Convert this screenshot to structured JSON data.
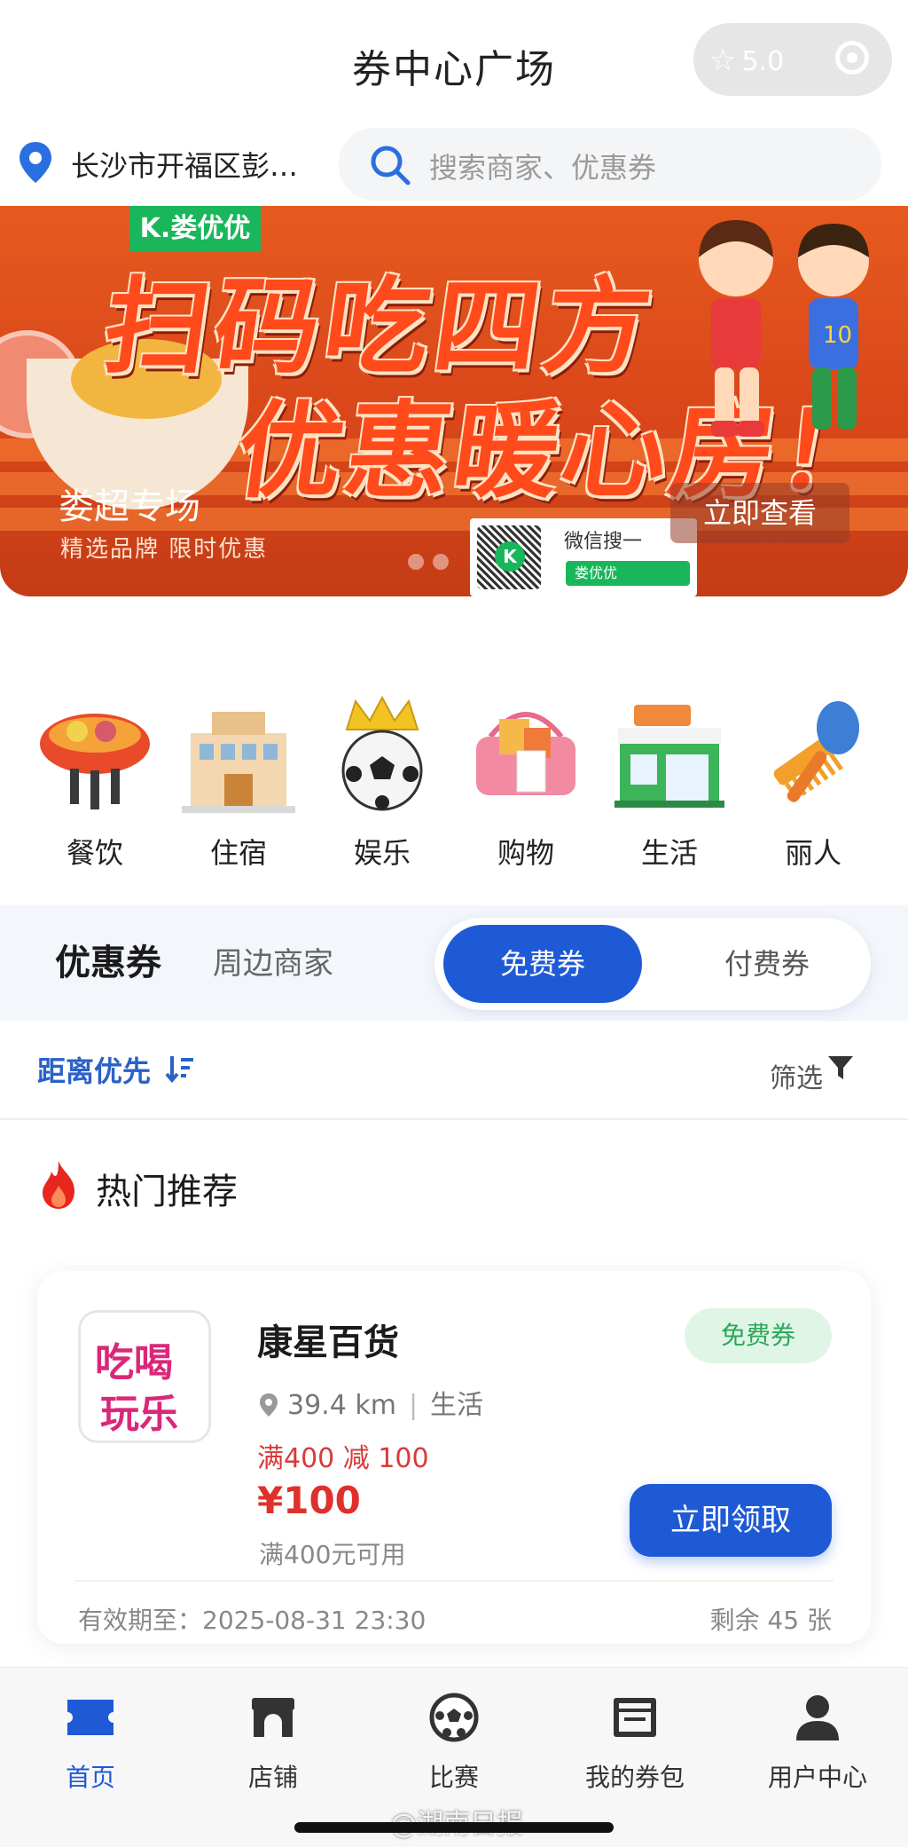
{
  "header": {
    "title": "券中心广场",
    "rating": "5.0"
  },
  "location": {
    "text": "长沙市开福区彭…"
  },
  "search": {
    "placeholder": "搜索商家、优惠券"
  },
  "banner": {
    "brand": "K.娄优优",
    "headline1": "扫码吃四方",
    "headline2": "优惠暖心房！",
    "subtitle": "娄超专场",
    "tagline": "精选品牌 限时优惠",
    "cta": "立即查看",
    "qr_text": "微信搜一",
    "qr_bar": "娄优优",
    "qr_center": "K"
  },
  "categories": [
    {
      "label": "餐饮",
      "icon": "grill-icon"
    },
    {
      "label": "住宿",
      "icon": "hotel-icon"
    },
    {
      "label": "娱乐",
      "icon": "soccer-crown-icon"
    },
    {
      "label": "购物",
      "icon": "shopping-basket-icon"
    },
    {
      "label": "生活",
      "icon": "market-icon"
    },
    {
      "label": "丽人",
      "icon": "comb-brush-icon"
    }
  ],
  "tabs": {
    "primary": "优惠券",
    "secondary": "周边商家",
    "segment_active": "免费券",
    "segment_inactive": "付费券"
  },
  "sort": {
    "distance": "距离优先",
    "filter": "筛选"
  },
  "section": {
    "title": "热门推荐"
  },
  "card": {
    "logo_line1": "吃喝",
    "logo_line2": "玩乐",
    "name": "康星百货",
    "badge": "免费券",
    "distance": "39.4 km",
    "category": "生活",
    "rule": "满400 减 100",
    "price": "¥100",
    "condition": "满400元可用",
    "button": "立即领取",
    "expiry": "有效期至：2025-08-31 23:30",
    "remaining": "剩余 45 张"
  },
  "bottom_nav": [
    {
      "label": "首页",
      "icon": "ticket-icon",
      "active": true
    },
    {
      "label": "店铺",
      "icon": "store-icon",
      "active": false
    },
    {
      "label": "比赛",
      "icon": "soccer-ball-icon",
      "active": false
    },
    {
      "label": "我的券包",
      "icon": "wallet-icon",
      "active": false
    },
    {
      "label": "用户中心",
      "icon": "user-icon",
      "active": false
    }
  ],
  "watermark": "@湖南日报",
  "colors": {
    "primary": "#1f5ad6",
    "price_red": "#e0302c",
    "badge_green": "#2ba75a",
    "banner_orange": "#e65a1e"
  }
}
